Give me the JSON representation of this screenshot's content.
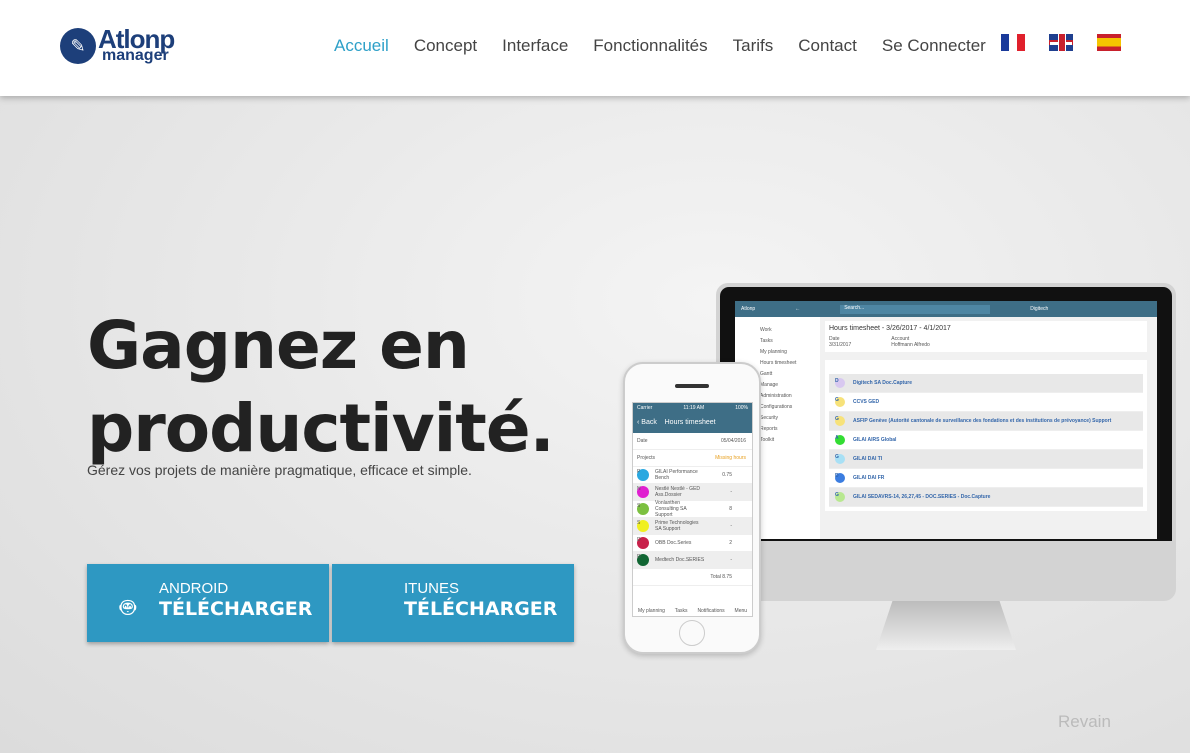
{
  "logo": {
    "line1": "Atlonp",
    "line2": "manager"
  },
  "nav": {
    "items": [
      "Accueil",
      "Concept",
      "Interface",
      "Fonctionnalités",
      "Tarifs",
      "Contact",
      "Se Connecter"
    ],
    "active": "Accueil",
    "active_color": "#2ea0c8"
  },
  "languages": [
    "fr",
    "en",
    "es"
  ],
  "hero": {
    "title_line1": "Gagnez en",
    "title_line2": "productivité.",
    "subtitle": "Gérez vos projets de manière pragmatique, efficace et simple."
  },
  "buttons": [
    {
      "platform": "ANDROID",
      "label": "TÉLÉCHARGER",
      "icon": "android-icon"
    },
    {
      "platform": "ITUNES",
      "label": "TÉLÉCHARGER",
      "icon": "apple-icon"
    }
  ],
  "button_color": "#2e98c2",
  "desktop_app": {
    "search": "Search...",
    "user": "Digitech",
    "sidebar": [
      "Work",
      "Tasks",
      "My planning",
      "Hours timesheet",
      "Gantt",
      "Manage",
      "Administration",
      "Configurations",
      "Security",
      "Reports",
      "Toolkit"
    ],
    "title": "Hours timesheet - 3/26/2017 - 4/1/2017",
    "date_label": "Date",
    "date": "3/31/2017",
    "account_label": "Account",
    "account": "Hoffmann Alfredo",
    "rows": [
      {
        "letter": "D",
        "name": "Digitech SA Doc.Capture",
        "color": "#d8c8f0"
      },
      {
        "letter": "G",
        "name": "CCVS GED",
        "color": "#f7e27a"
      },
      {
        "letter": "G",
        "name": "ASFIP Genève (Autorité cantonale de surveillance des fondations et des institutions de prévoyance) Support",
        "color": "#f7e27a"
      },
      {
        "letter": "A",
        "name": "GILAI AIRS Global",
        "color": "#33dd33"
      },
      {
        "letter": "G",
        "name": "GILAI DAI TI",
        "color": "#a8e0f5"
      },
      {
        "letter": "D",
        "name": "GILAI DAI FR",
        "color": "#3b7de0"
      },
      {
        "letter": "G",
        "name": "GILAI SEDAVRS-14, 26,27,45 - DOC.SERIES - Doc.Capture",
        "color": "#b8e890"
      }
    ]
  },
  "mobile_app": {
    "carrier": "Carrier",
    "time": "11:19 AM",
    "battery": "100%",
    "back": "Back",
    "title": "Hours timesheet",
    "date_label": "Date",
    "date": "05/04/2016",
    "projects_label": "Projects",
    "week": "Missing hours",
    "rows": [
      {
        "letter": "P",
        "name": "GILAI Performance Bench",
        "value": "0.75",
        "color": "#2aa8e0"
      },
      {
        "letter": "N",
        "name": "Nestlé Nestlé - GED Ass.Dossier",
        "value": "-",
        "color": "#e020d0"
      },
      {
        "letter": "S",
        "name": "Vonlanthen Consulting SA Support",
        "value": "8",
        "color": "#7cc040"
      },
      {
        "letter": "S",
        "name": "Prime Technologies SA Support",
        "value": "-",
        "color": "#f0f020"
      },
      {
        "letter": "D",
        "name": "OBB Doc.Series",
        "value": "2",
        "color": "#c8204a"
      },
      {
        "letter": "D",
        "name": "Medtech Doc.SERIES",
        "value": "-",
        "color": "#116633"
      }
    ],
    "total_label": "Total",
    "total": "8.75",
    "tabs": [
      "My planning",
      "Tasks",
      "Notifications",
      "Menu"
    ]
  },
  "watermark": "Revain"
}
